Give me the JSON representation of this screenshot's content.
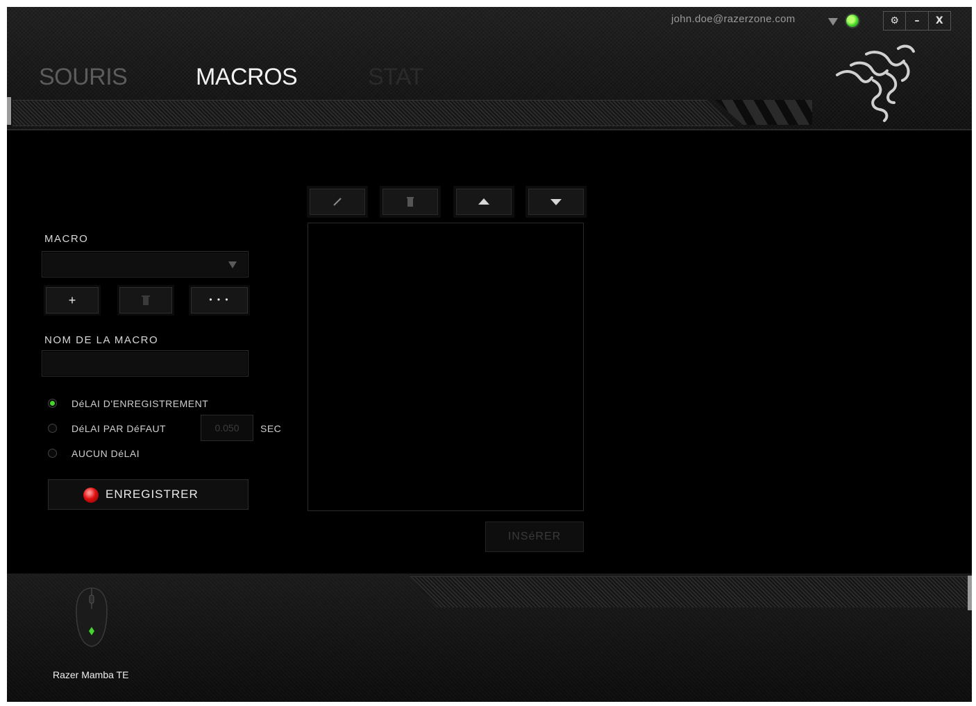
{
  "header": {
    "tabs": [
      {
        "label": "SOURIS"
      },
      {
        "label": "MACROS",
        "active": true
      },
      {
        "label": "STAT"
      }
    ],
    "account_email": "john.doe@razerzone.com",
    "status_color": "#44d62c",
    "window_buttons": {
      "settings": "⚙",
      "minimize": "–",
      "close": "X"
    }
  },
  "macro_panel": {
    "macro_label": "MACRO",
    "macro_select_value": "",
    "buttons": {
      "add": "+",
      "more": "• • •"
    },
    "name_label": "NOM DE LA MACRO",
    "name_value": "",
    "delay_options": [
      {
        "label": "DéLAI D'ENREGISTREMENT",
        "selected": true
      },
      {
        "label": "DéLAI PAR DéFAUT",
        "selected": false
      },
      {
        "label": "AUCUN DéLAI",
        "selected": false
      }
    ],
    "default_delay_value": "0.050",
    "delay_unit": "SEC",
    "record_label": "ENREGISTRER"
  },
  "editor": {
    "toolbar_icons": [
      "pencil-icon",
      "trash-icon",
      "move-up-icon",
      "move-down-icon"
    ],
    "insert_label": "INSéRER"
  },
  "footer": {
    "device_name": "Razer Mamba TE"
  },
  "colors": {
    "accent_green": "#44d62c",
    "record_red": "#e01010",
    "background": "#000000"
  }
}
